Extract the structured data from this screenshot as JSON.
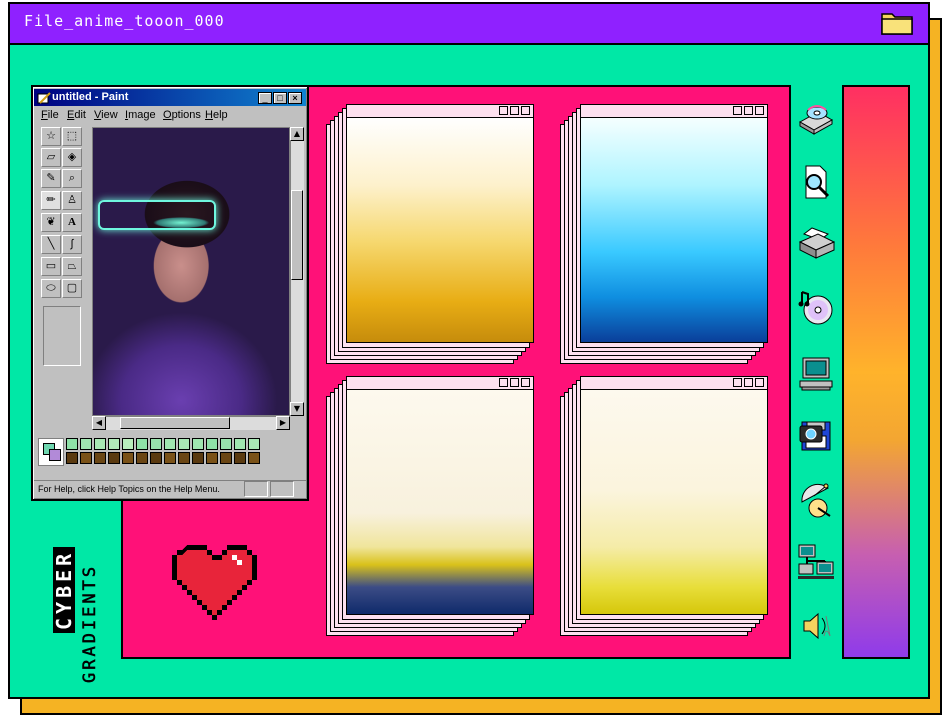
{
  "window": {
    "title": "File_anime_tooon_000",
    "colors": {
      "titlebar": "#8f21ff",
      "body": "#00e8a6",
      "shadow": "#f5b323",
      "panel": "#ff1178"
    }
  },
  "paint": {
    "title": "untitled - Paint",
    "menu": [
      "File",
      "Edit",
      "View",
      "Image",
      "Options",
      "Help"
    ],
    "status": "For Help, click Help Topics on the Help Menu.",
    "window_buttons": [
      "_",
      "□",
      "×"
    ]
  },
  "cards": [
    {
      "name": "gradient-card-yellow",
      "gradient": [
        "#ffffff",
        "#fdeaa6",
        "#f9d04a",
        "#e7aa16",
        "#c98f0d"
      ]
    },
    {
      "name": "gradient-card-blue",
      "gradient": [
        "#f5ffff",
        "#9ef2ff",
        "#33c6ff",
        "#0f8fe0",
        "#0a3f9a"
      ]
    },
    {
      "name": "gradient-card-navy-gold",
      "gradient": [
        "#fdf9ee",
        "#f8f1dd",
        "#efe3a8",
        "#d9c21a",
        "#1f3d8a",
        "#0f2a6a"
      ]
    },
    {
      "name": "gradient-card-lemon",
      "gradient": [
        "#fdf9ee",
        "#fbf4dd",
        "#f6eeb0",
        "#e9df3a",
        "#d5c70a"
      ]
    }
  ],
  "side_text": {
    "word1": "CYBER",
    "word2": "GRADIENTS"
  },
  "icons": [
    "disk-drive-icon",
    "find-file-icon",
    "printer-icon",
    "music-cd-icon",
    "computer-icon",
    "camera-floppy-icon",
    "satellite-dish-icon",
    "network-icon",
    "speaker-icon"
  ]
}
